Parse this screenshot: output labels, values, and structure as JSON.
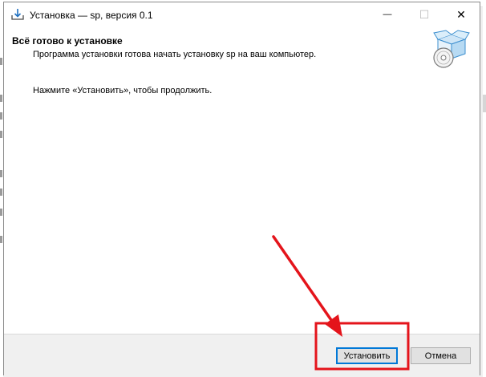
{
  "window": {
    "title": "Установка — sp, версия 0.1",
    "minimize_symbol": "—",
    "maximize_symbol": "☐",
    "close_symbol": "✕"
  },
  "page": {
    "heading": "Всё готово к установке",
    "subheading": "Программа установки готова начать установку sp на ваш компьютер.",
    "instruction": "Нажмите «Установить», чтобы продолжить."
  },
  "buttons": {
    "install": "Установить",
    "cancel": "Отмена"
  },
  "annotation": {
    "color": "#e4141b"
  },
  "icons": {
    "app": "installer-download-icon",
    "package": "software-box-cd-icon"
  }
}
